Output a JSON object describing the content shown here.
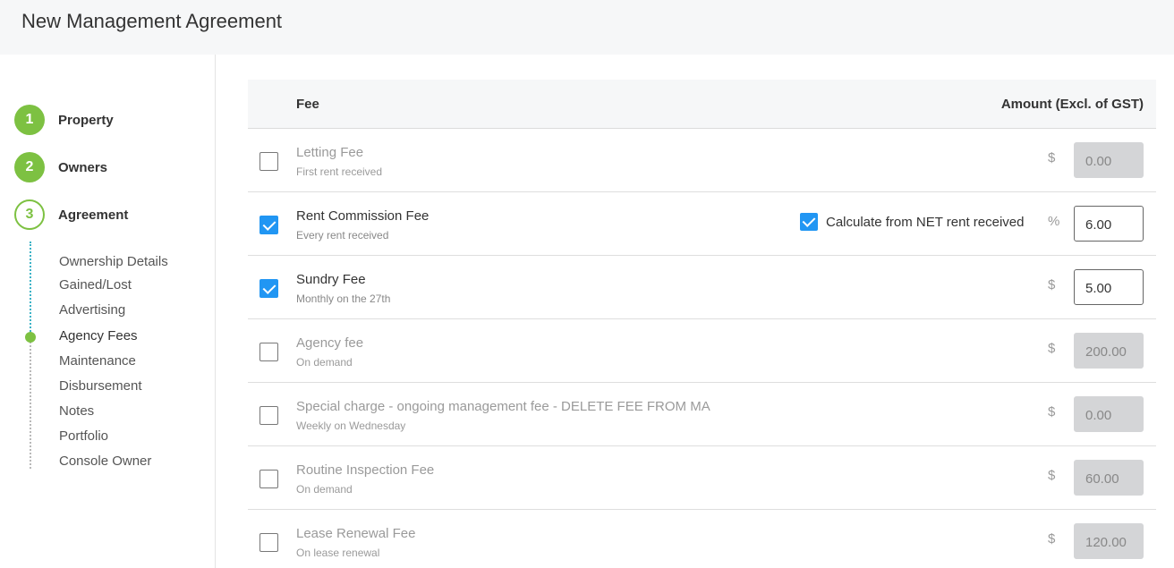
{
  "header": {
    "title": "New Management Agreement"
  },
  "steps": [
    {
      "number": "1",
      "label": "Property"
    },
    {
      "number": "2",
      "label": "Owners"
    },
    {
      "number": "3",
      "label": "Agreement"
    }
  ],
  "substeps": [
    "Ownership Details",
    "Gained/Lost",
    "Advertising",
    "Agency Fees",
    "Maintenance",
    "Disbursement",
    "Notes",
    "Portfolio",
    "Console Owner"
  ],
  "table": {
    "col_fee": "Fee",
    "col_amount": "Amount (Excl. of GST)"
  },
  "fees": [
    {
      "name": "Letting Fee",
      "sub": "First rent received",
      "unit": "$",
      "amount": "0.00",
      "checked": false
    },
    {
      "name": "Rent Commission Fee",
      "sub": "Every rent received",
      "unit": "%",
      "amount": "6.00",
      "checked": true,
      "calc_label": "Calculate from NET rent received"
    },
    {
      "name": "Sundry Fee",
      "sub": "Monthly on the 27th",
      "unit": "$",
      "amount": "5.00",
      "checked": true
    },
    {
      "name": "Agency fee",
      "sub": "On demand",
      "unit": "$",
      "amount": "200.00",
      "checked": false
    },
    {
      "name": "Special charge - ongoing management fee - DELETE FEE FROM MA",
      "sub": "Weekly on Wednesday",
      "unit": "$",
      "amount": "0.00",
      "checked": false
    },
    {
      "name": "Routine Inspection Fee",
      "sub": "On demand",
      "unit": "$",
      "amount": "60.00",
      "checked": false
    },
    {
      "name": "Lease Renewal Fee",
      "sub": "On lease renewal",
      "unit": "$",
      "amount": "120.00",
      "checked": false
    }
  ],
  "colors": {
    "accent_green": "#7dc142",
    "checkbox_blue": "#2196f3",
    "progress_teal": "#3bb2c6"
  }
}
